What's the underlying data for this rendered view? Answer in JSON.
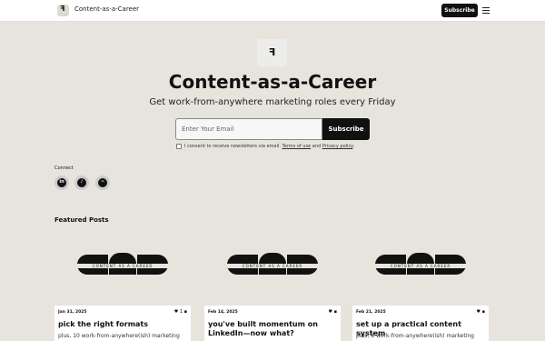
{
  "header": {
    "brand": "Content-as-a-Career",
    "subscribe_label": "Subscribe"
  },
  "hero": {
    "title": "Content-as-a-Career",
    "subtitle": "Get work-from-anywhere marketing roles every Friday",
    "email_placeholder": "Enter Your Email",
    "subscribe_label": "Subscribe",
    "consent": {
      "prefix": "I consent to receive newsletters via email.",
      "terms": "Terms of use",
      "and": "and",
      "privacy": "Privacy policy",
      "suffix": "."
    }
  },
  "connect": {
    "label": "Connect",
    "items": [
      {
        "icon": "linkedin-icon",
        "glyph": "in"
      },
      {
        "icon": "tiktok-icon",
        "glyph": "♪"
      },
      {
        "icon": "rss-icon",
        "glyph": "~"
      }
    ]
  },
  "featured": {
    "heading": "Featured Posts",
    "logo_tag": "CONTENT AS A CAREER",
    "posts": [
      {
        "date": "Jan 31, 2025",
        "likes": "1",
        "title": "pick the right formats",
        "excerpt": "plus, 10 work-from-anywhere(ish) marketing"
      },
      {
        "date": "Feb 14, 2025",
        "likes": "",
        "title": "you've built momentum on LinkedIn—now what?",
        "excerpt": ""
      },
      {
        "date": "Feb 21, 2025",
        "likes": "",
        "title": "set up a practical content system",
        "excerpt": "plus, 8 work-from-anywhere(ish) marketing"
      }
    ]
  }
}
